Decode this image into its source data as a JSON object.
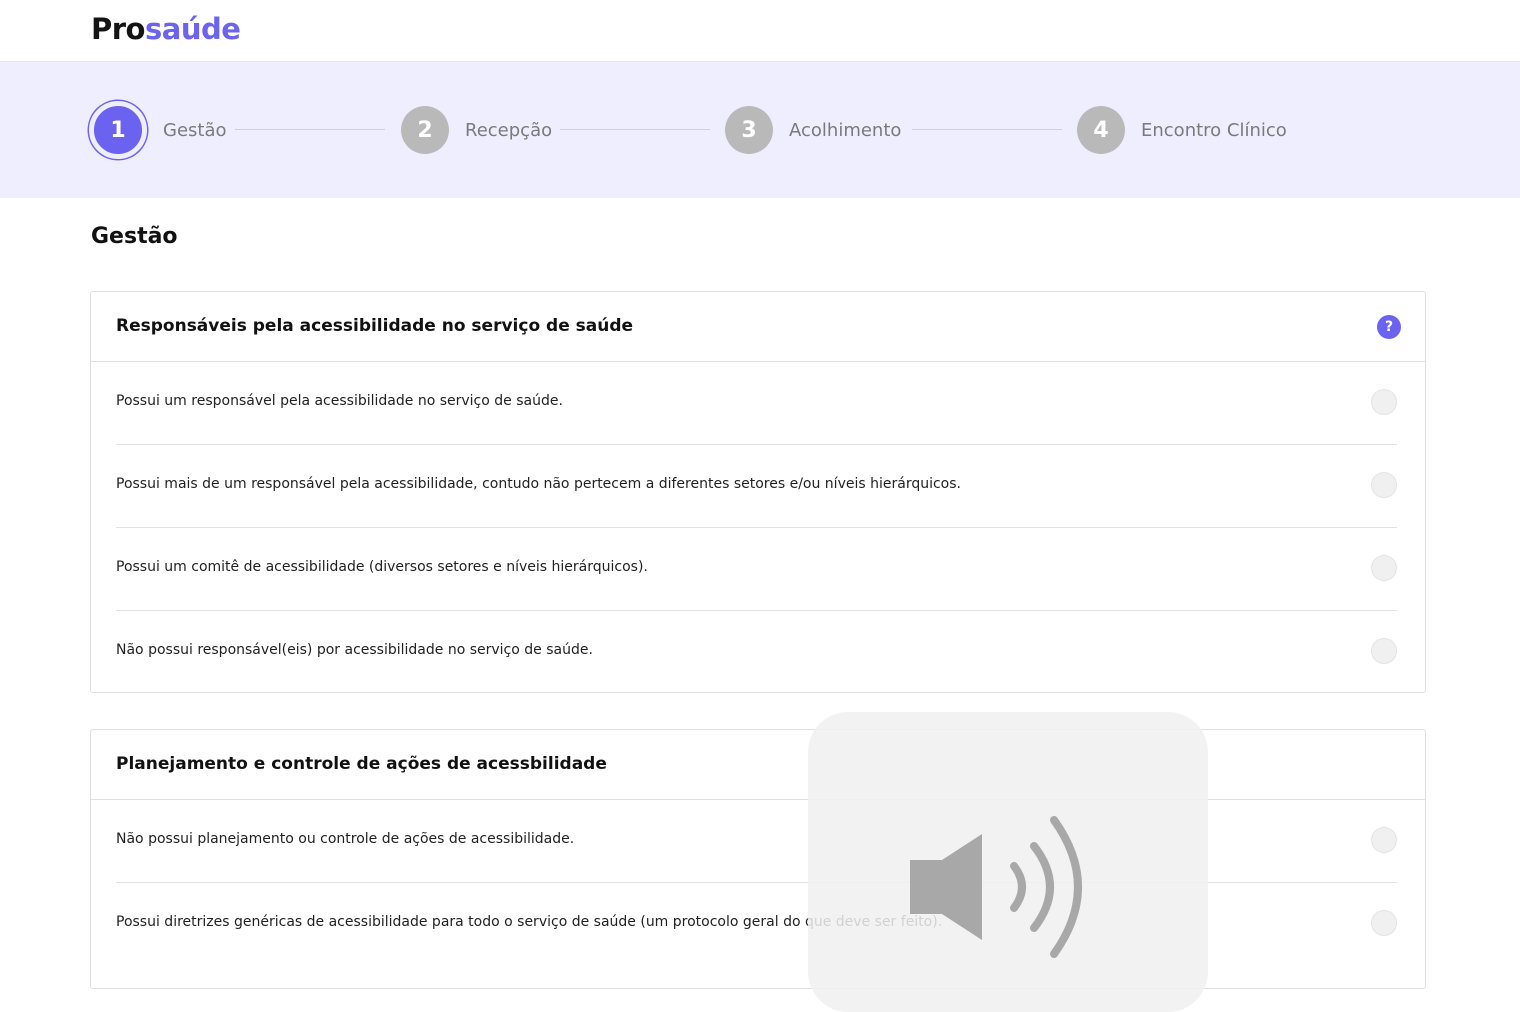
{
  "header": {
    "logo_part1": "Pro",
    "logo_part2": "saúde"
  },
  "stepper": {
    "steps": [
      {
        "number": "1",
        "label": "Gestão",
        "active": true
      },
      {
        "number": "2",
        "label": "Recepção",
        "active": false
      },
      {
        "number": "3",
        "label": "Acolhimento",
        "active": false
      },
      {
        "number": "4",
        "label": "Encontro Clínico",
        "active": false
      }
    ]
  },
  "page": {
    "title": "Gestão"
  },
  "cards": [
    {
      "title": "Responsáveis pela acessibilidade no serviço de saúde",
      "help_icon": "?",
      "options": [
        "Possui um responsável pela acessibilidade no serviço de saúde.",
        "Possui mais de um responsável pela acessibilidade, contudo não pertecem a diferentes setores e/ou níveis hierárquicos.",
        "Possui um comitê de acessibilidade (diversos setores e níveis hierárquicos).",
        "Não possui responsável(eis) por acessibilidade no serviço de saúde."
      ]
    },
    {
      "title": "Planejamento e controle de ações de acessbilidade",
      "options": [
        "Não possui planejamento ou controle de ações de acessibilidade.",
        "Possui diretrizes genéricas de acessibilidade para todo o serviço de saúde (um protocolo geral do que deve ser feito)."
      ]
    }
  ],
  "colors": {
    "accent": "#6b63ef",
    "stepper_bg": "#efeeff",
    "inactive_step": "#b9b9b9"
  },
  "overlay": {
    "icon": "speaker-volume-icon"
  }
}
